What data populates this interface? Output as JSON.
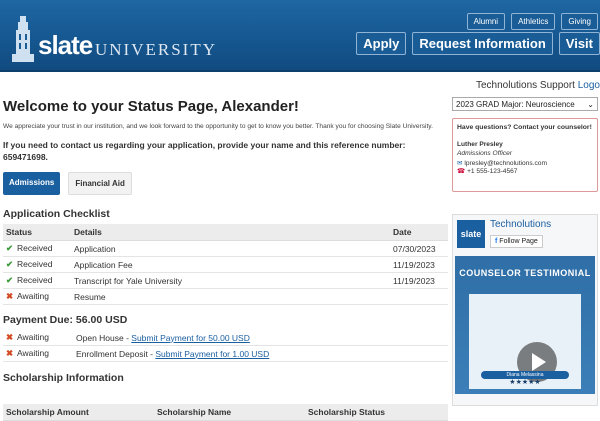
{
  "header": {
    "logo_slate": "slate",
    "logo_university": "UNIVERSITY",
    "top_links": [
      "Alumni",
      "Athletics",
      "Giving"
    ],
    "nav": [
      "Apply",
      "Request Information",
      "Visit"
    ]
  },
  "support": {
    "prefix": "Technolutions Support",
    "logout": "Logo"
  },
  "main": {
    "title": "Welcome to your Status Page, Alexander!",
    "intro": "We appreciate your trust in our institution, and we look forward to the opportunity to get to know you better. Thank you for choosing Slate University.",
    "contact_line": "If you need to contact us regarding your application, provide your name and this reference number:",
    "reference_number": "659471698.",
    "tabs": [
      "Admissions",
      "Financial Aid"
    ],
    "checklist_title": "Application Checklist",
    "checklist_headers": [
      "Status",
      "Details",
      "Date"
    ],
    "checklist": [
      {
        "status": "Received",
        "details": "Application",
        "date": "07/30/2023"
      },
      {
        "status": "Received",
        "details": "Application Fee",
        "date": "11/19/2023"
      },
      {
        "status": "Received",
        "details": "Transcript for Yale University",
        "date": "11/19/2023"
      },
      {
        "status": "Awaiting",
        "details": "Resume",
        "date": ""
      }
    ],
    "payment_title": "Payment Due: 56.00 USD",
    "payments": [
      {
        "status": "Awaiting",
        "item": "Open House - ",
        "link": "Submit Payment for 50.00 USD"
      },
      {
        "status": "Awaiting",
        "item": "Enrollment Deposit - ",
        "link": "Submit Payment for 1.00 USD"
      }
    ],
    "scholarship_title": "Scholarship Information",
    "scholarship_headers": [
      "Scholarship Amount",
      "Scholarship Name",
      "Scholarship Status"
    ]
  },
  "sidebar": {
    "select_value": "2023 GRAD Major: Neuroscience",
    "counselor": {
      "question": "Have questions? Contact your counselor!",
      "name": "Luther Presley",
      "role": "Admissions Officer",
      "email": "lpresley@technolutions.com",
      "phone": "+1 555-123-4567"
    },
    "facebook": {
      "logo": "slate",
      "name": "Technolutions",
      "follow": "Follow Page",
      "video_title": "COUNSELOR TESTIMONIAL",
      "video_person": "Diana Melassina"
    }
  }
}
